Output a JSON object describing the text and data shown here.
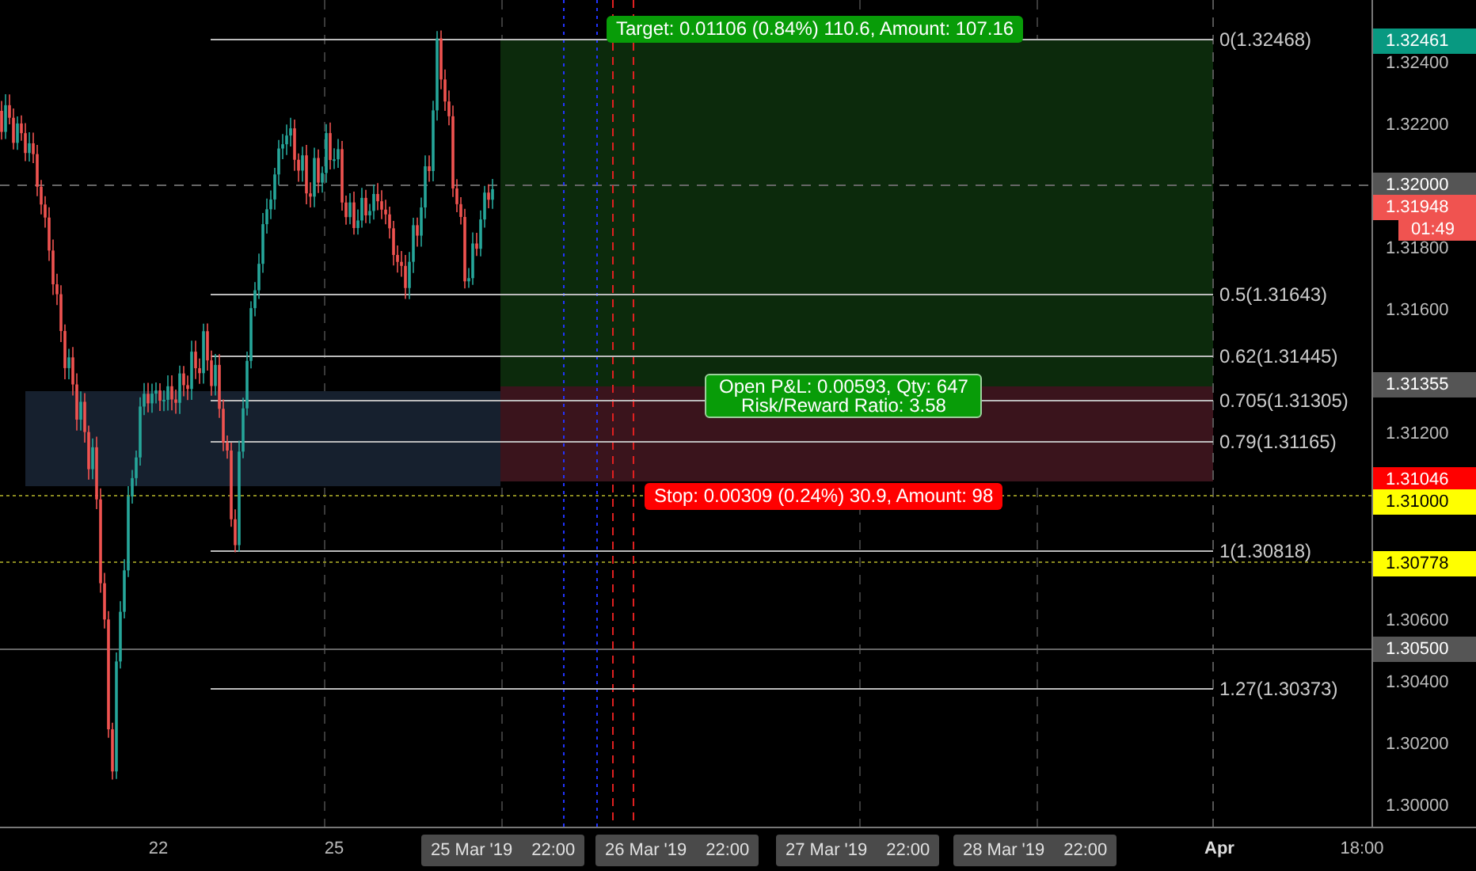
{
  "chart": {
    "position_tool": {
      "target_label": "Target: 0.01106 (0.84%) 110.6, Amount: 107.16",
      "pnl_label": [
        "Open P&L: 0.00593, Qty: 647",
        "Risk/Reward Ratio: 3.58"
      ],
      "stop_label": "Stop: 0.00309 (0.24%) 30.9, Amount: 98"
    },
    "fib_levels": [
      "0(1.32468)",
      "0.5(1.31643)",
      "0.62(1.31445)",
      "0.705(1.31305)",
      "0.79(1.31165)",
      "1(1.30818)",
      "1.27(1.30373)"
    ]
  },
  "price_axis": {
    "ticks": [
      "1.32400",
      "1.32200",
      "1.31800",
      "1.31600",
      "1.31200",
      "1.30600",
      "1.30400",
      "1.30200",
      "1.30000"
    ],
    "tags": [
      {
        "text": "1.32461",
        "color": "#089981"
      },
      {
        "text": "1.32000",
        "color": "#555555"
      },
      {
        "text": "1.31948",
        "color": "#f05350"
      },
      {
        "text": "01:49",
        "color": "#f05350"
      },
      {
        "text": "1.31355",
        "color": "#555555"
      },
      {
        "text": "1.31046",
        "color": "#ff0000"
      },
      {
        "text": "1.31000",
        "color": "#ffff00"
      },
      {
        "text": "1.30778",
        "color": "#ffff00"
      },
      {
        "text": "1.30500",
        "color": "#555555"
      }
    ]
  },
  "time_axis": {
    "labels": [
      {
        "kind": "tick",
        "text": "22"
      },
      {
        "kind": "tick",
        "text": "25"
      },
      {
        "kind": "range",
        "date": "25 Mar '19",
        "time": "22:00"
      },
      {
        "kind": "range",
        "date": "26 Mar '19",
        "time": "22:00"
      },
      {
        "kind": "range",
        "date": "27 Mar '19",
        "time": "22:00"
      },
      {
        "kind": "range",
        "date": "28 Mar '19",
        "time": "22:00"
      },
      {
        "kind": "month",
        "text": "Apr"
      },
      {
        "kind": "tick",
        "text": "18:00"
      }
    ]
  }
}
